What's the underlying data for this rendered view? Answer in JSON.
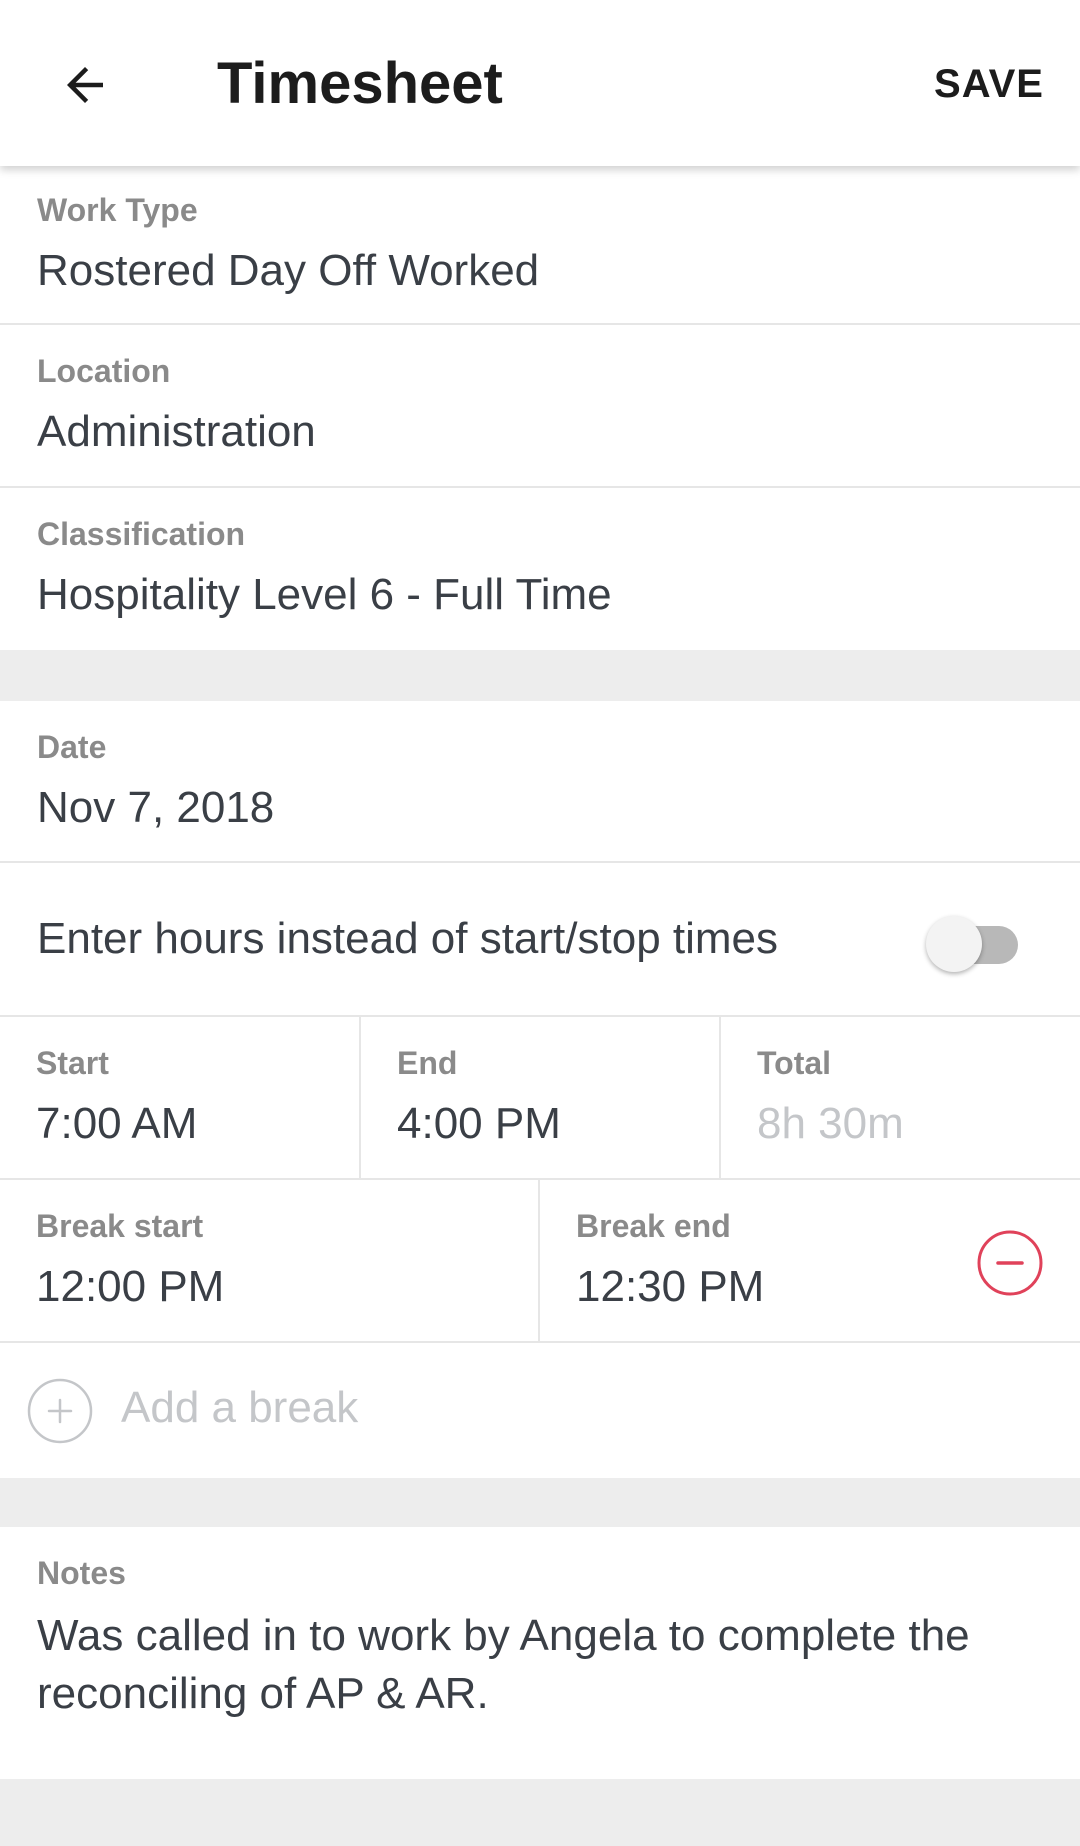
{
  "header": {
    "title": "Timesheet",
    "save_label": "SAVE",
    "back_icon": "arrow-left-icon"
  },
  "job": {
    "work_type_label": "Work Type",
    "work_type_value": "Rostered Day Off Worked",
    "location_label": "Location",
    "location_value": "Administration",
    "classification_label": "Classification",
    "classification_value": "Hospitality Level 6 - Full Time"
  },
  "time": {
    "date_label": "Date",
    "date_value": "Nov 7, 2018",
    "hours_toggle_label": "Enter hours instead of start/stop times",
    "hours_toggle_on": false,
    "start_label": "Start",
    "start_value": "7:00 AM",
    "end_label": "End",
    "end_value": "4:00 PM",
    "total_label": "Total",
    "total_value": "8h 30m",
    "break_start_label": "Break start",
    "break_start_value": "12:00 PM",
    "break_end_label": "Break end",
    "break_end_value": "12:30 PM",
    "remove_break_icon": "minus-circle-icon",
    "add_break_icon": "plus-circle-icon",
    "add_break_label": "Add a break"
  },
  "notes": {
    "label": "Notes",
    "text": "Was called in to work by Angela to complete the reconciling of AP & AR."
  },
  "colors": {
    "danger": "#e0425a",
    "muted": "#c4c6c9",
    "label": "#8a8a8a",
    "text": "#3a3f46",
    "divider": "#e6e6e6",
    "background": "#ededed"
  }
}
